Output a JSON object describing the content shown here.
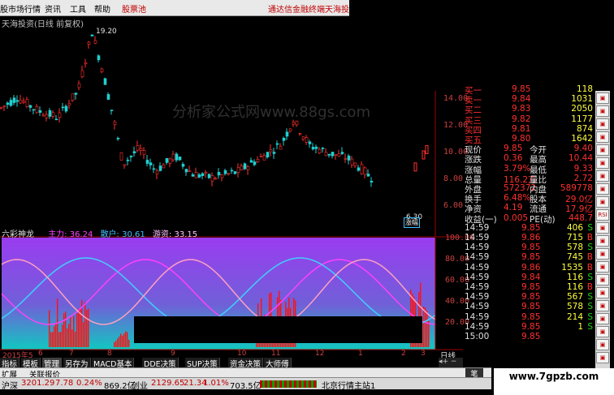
{
  "menu": {
    "items": [
      "股市场行情",
      "资讯",
      "工具",
      "帮助"
    ],
    "stock_pool": "股票池",
    "broker_link": "通达信金融终端",
    "brand": "天海投"
  },
  "chart": {
    "title": "天海投资(日线 前复权)",
    "watermark": "分析家公式网www.88gs.com",
    "high_label": "19.20",
    "low_label": "6.30",
    "price_axis": [
      "14.00",
      "12.00",
      "10.00",
      "8.00",
      "6.00"
    ],
    "indicator_axis": [
      "100.00",
      "80.00",
      "60.00",
      "40.00",
      "20.00"
    ],
    "x_axis": [
      "2015年5",
      "6",
      "7",
      "8",
      "9",
      "10",
      "11",
      "12",
      "1",
      "2",
      "3"
    ],
    "axis_unit": "日线",
    "max_badge": "涨幅"
  },
  "indicator": {
    "name": "六彩神龙",
    "main_label": "主力: 36.24",
    "retail_label": "散户: 30.61",
    "speculator_label": "游资: 33.15"
  },
  "quote": {
    "asks": [
      {
        "label": "卖一",
        "price": "9.84",
        "vol": "1031"
      },
      {
        "label": "买二",
        "price": "9.83",
        "vol": "2050"
      },
      {
        "label": "买三",
        "price": "9.82",
        "vol": "1177"
      },
      {
        "label": "买四",
        "price": "9.81",
        "vol": "874"
      },
      {
        "label": "买五",
        "price": "9.80",
        "vol": "1642"
      }
    ],
    "top_partial": {
      "label": "买一",
      "price": "9.85",
      "vol": "118"
    },
    "stats": [
      {
        "l1": "现价",
        "v1": "9.85",
        "l2": "今开",
        "v2": "9.40"
      },
      {
        "l1": "涨跌",
        "v1": "0.36",
        "l2": "最高",
        "v2": "10.44"
      },
      {
        "l1": "涨幅",
        "v1": "3.79%",
        "l2": "最低",
        "v2": "9.33"
      },
      {
        "l1": "总量",
        "v1": "116.2万",
        "l2": "量比",
        "v2": "2.72"
      },
      {
        "l1": "外盘",
        "v1": "572372",
        "l2": "内盘",
        "v2": "589778"
      },
      {
        "l1": "换手",
        "v1": "6.48%",
        "l2": "股本",
        "v2": "29.0亿"
      },
      {
        "l1": "净资",
        "v1": "4.19",
        "l2": "流通",
        "v2": "17.9亿"
      },
      {
        "l1": "收益(一)",
        "v1": "0.005",
        "l2": "PE(动)",
        "v2": "448.7"
      }
    ],
    "ticks": [
      {
        "time": "14:59",
        "price": "9.85",
        "vol": "406",
        "side": "S"
      },
      {
        "time": "14:59",
        "price": "9.86",
        "vol": "715",
        "side": "B"
      },
      {
        "time": "14:59",
        "price": "9.85",
        "vol": "578",
        "side": "S"
      },
      {
        "time": "14:59",
        "price": "9.85",
        "vol": "745",
        "side": "B"
      },
      {
        "time": "14:59",
        "price": "9.86",
        "vol": "1535",
        "side": "B"
      },
      {
        "time": "14:59",
        "price": "9.84",
        "vol": "116",
        "side": "S"
      },
      {
        "time": "14:59",
        "price": "9.85",
        "vol": "116",
        "side": "B"
      },
      {
        "time": "14:59",
        "price": "9.85",
        "vol": "567",
        "side": "S"
      },
      {
        "time": "14:59",
        "price": "9.85",
        "vol": "578",
        "side": "S"
      },
      {
        "time": "14:59",
        "price": "9.85",
        "vol": "214",
        "side": "S"
      },
      {
        "time": "14:59",
        "price": "9.85",
        "vol": "1",
        "side": "S"
      },
      {
        "time": "15:00",
        "price": "9.85",
        "vol": "",
        "side": ""
      }
    ]
  },
  "toolbar_buttons": [
    "",
    "",
    "",
    "",
    "",
    "",
    "",
    "",
    "",
    "RSI",
    "",
    "",
    "",
    "",
    "",
    "",
    "",
    "",
    "",
    "",
    ""
  ],
  "bottom_tabs": [
    "指标",
    "模板",
    "管理",
    "另存为",
    "MACD基本",
    "DDE决策",
    "SUP决策",
    "资金决策",
    "大师傅"
  ],
  "ext_tabs": [
    "扩展",
    "关联报价"
  ],
  "status": {
    "index1_name": "沪深",
    "index1_value": "3201.29",
    "index1_change": "7.78",
    "index1_pct": "0.24%",
    "index1_amount": "869.2亿",
    "index2_name": "创业",
    "index2_value": "2129.65",
    "index2_change": "21.34",
    "index2_pct": "1.01%",
    "index2_amount": "703.5亿",
    "server": "北京行情主站1"
  },
  "footer_tab": "笔",
  "site_watermark": "www.7gpzb.com",
  "colors": {
    "up": "#ff3030",
    "down": "#20d0d0",
    "panel_bg": "#000000",
    "indicator_bg_top": "#8a2be2",
    "indicator_bg_bottom": "#00c0c0"
  }
}
